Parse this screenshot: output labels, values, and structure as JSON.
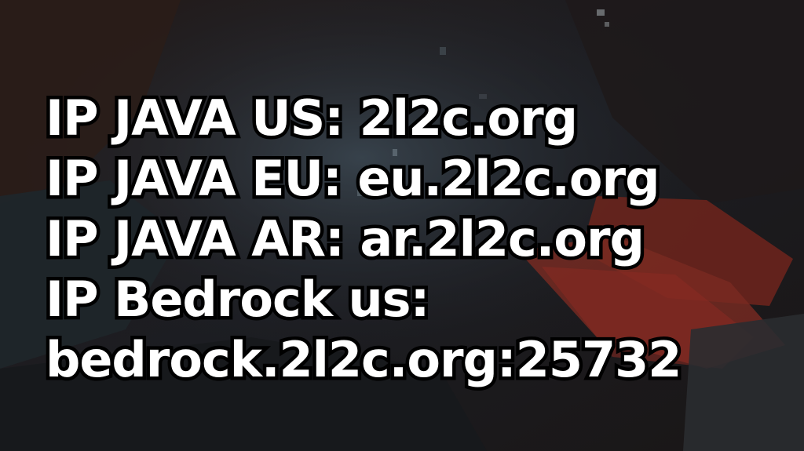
{
  "lines": [
    "IP JAVA US: 2l2c.org",
    "IP JAVA EU: eu.2l2c.org",
    "IP JAVA AR: ar.2l2c.org",
    "IP Bedrock us:",
    "bedrock.2l2c.org:25732"
  ],
  "colors": {
    "text_fill": "#ffffff",
    "text_outline": "#000000",
    "background": "#1a1a1e",
    "accent_red": "#8a2a22"
  }
}
